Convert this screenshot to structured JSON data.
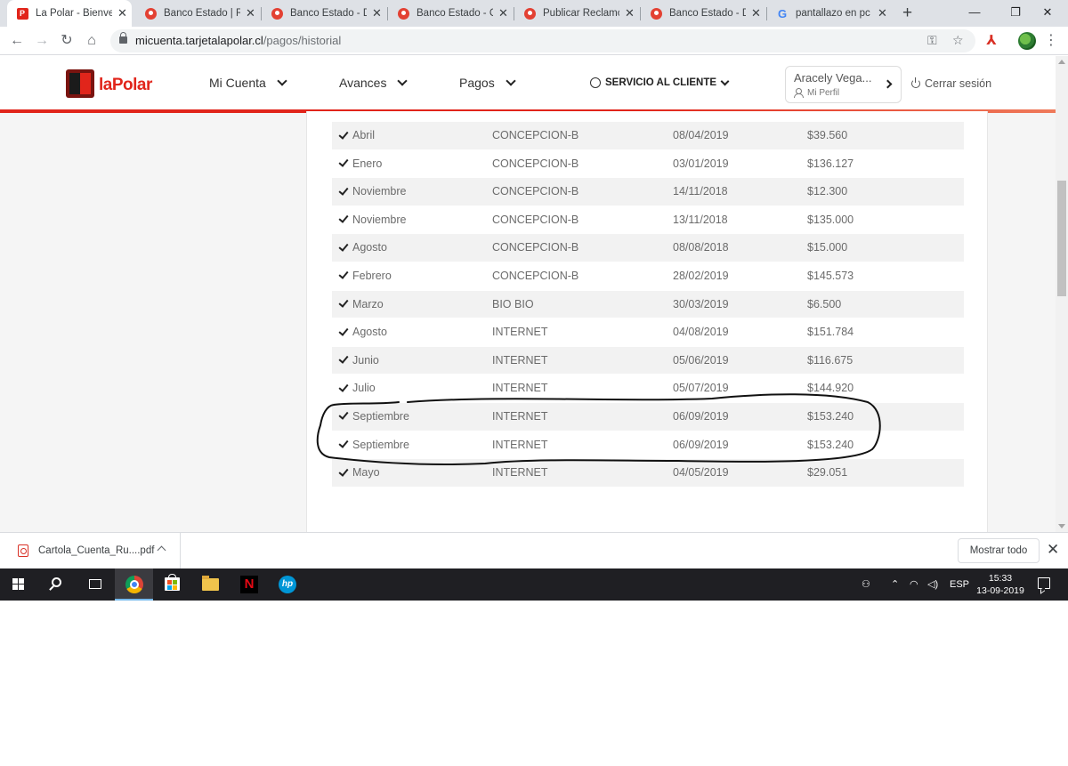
{
  "browser": {
    "tabs": [
      {
        "title": "La Polar - Bienven",
        "active": true,
        "icon": "lapolar-favicon"
      },
      {
        "title": "Banco Estado | Re",
        "active": false,
        "icon": "reclamos-pin-icon"
      },
      {
        "title": "Banco Estado - De",
        "active": false,
        "icon": "reclamos-pin-icon"
      },
      {
        "title": "Banco Estado - Co",
        "active": false,
        "icon": "reclamos-pin-icon"
      },
      {
        "title": "Publicar Reclamo |",
        "active": false,
        "icon": "reclamos-pin-icon"
      },
      {
        "title": "Banco Estado - Du",
        "active": false,
        "icon": "reclamos-pin-icon"
      },
      {
        "title": "pantallazo en pc le",
        "active": false,
        "icon": "google-icon"
      }
    ],
    "url_domain": "micuenta.tarjetalapolar.cl",
    "url_path": "/pagos/historial"
  },
  "site": {
    "logo_text": "laPolar",
    "nav": {
      "mi_cuenta": "Mi Cuenta",
      "avances": "Avances",
      "pagos": "Pagos",
      "servicio": "SERVICIO AL CLIENTE"
    },
    "user": {
      "name": "Aracely Vega...",
      "profile": "Mi Perfil"
    },
    "logout": "Cerrar sesión"
  },
  "payments": [
    {
      "mes": "Abril",
      "lugar": "CONCEPCION-B",
      "fecha": "08/04/2019",
      "monto": "$39.560"
    },
    {
      "mes": "Enero",
      "lugar": "CONCEPCION-B",
      "fecha": "03/01/2019",
      "monto": "$136.127"
    },
    {
      "mes": "Noviembre",
      "lugar": "CONCEPCION-B",
      "fecha": "14/11/2018",
      "monto": "$12.300"
    },
    {
      "mes": "Noviembre",
      "lugar": "CONCEPCION-B",
      "fecha": "13/11/2018",
      "monto": "$135.000"
    },
    {
      "mes": "Agosto",
      "lugar": "CONCEPCION-B",
      "fecha": "08/08/2018",
      "monto": "$15.000"
    },
    {
      "mes": "Febrero",
      "lugar": "CONCEPCION-B",
      "fecha": "28/02/2019",
      "monto": "$145.573"
    },
    {
      "mes": "Marzo",
      "lugar": "BIO BIO",
      "fecha": "30/03/2019",
      "monto": "$6.500"
    },
    {
      "mes": "Agosto",
      "lugar": "INTERNET",
      "fecha": "04/08/2019",
      "monto": "$151.784"
    },
    {
      "mes": "Junio",
      "lugar": "INTERNET",
      "fecha": "05/06/2019",
      "monto": "$116.675"
    },
    {
      "mes": "Julio",
      "lugar": "INTERNET",
      "fecha": "05/07/2019",
      "monto": "$144.920"
    },
    {
      "mes": "Septiembre",
      "lugar": "INTERNET",
      "fecha": "06/09/2019",
      "monto": "$153.240"
    },
    {
      "mes": "Septiembre",
      "lugar": "INTERNET",
      "fecha": "06/09/2019",
      "monto": "$153.240"
    },
    {
      "mes": "Mayo",
      "lugar": "INTERNET",
      "fecha": "04/05/2019",
      "monto": "$29.051"
    }
  ],
  "downloads": {
    "file": "Cartola_Cuenta_Ru....pdf",
    "show_all": "Mostrar todo"
  },
  "taskbar": {
    "lang": "ESP",
    "time": "15:33",
    "date": "13-09-2019"
  },
  "colors": {
    "brand_red": "#e1251b",
    "annotation_ink": "#111111"
  }
}
